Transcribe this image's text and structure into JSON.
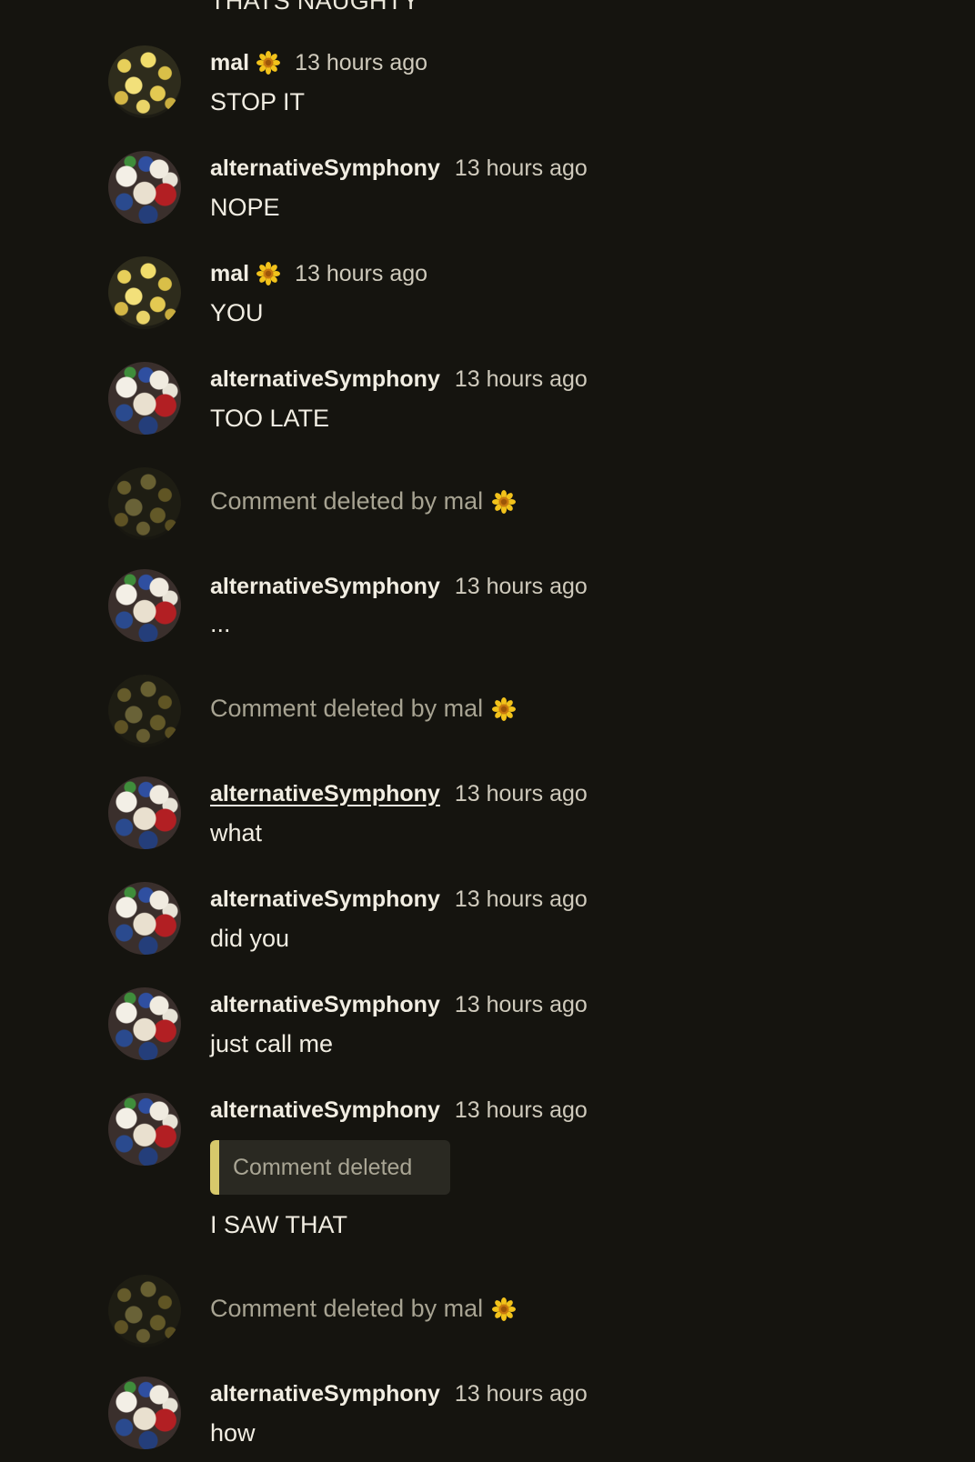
{
  "top_partial_text": "THATS NAUGHTY",
  "colors": {
    "background": "#15140f",
    "quote_bar": "#d7c96b",
    "muted_text": "#a7a392"
  },
  "icons": {
    "author_badge": "sunflower-icon"
  },
  "comments": [
    {
      "author": "mal",
      "time": "13 hours ago",
      "text": "STOP IT"
    },
    {
      "author": "alternativeSymphony",
      "time": "13 hours ago",
      "text": "NOPE"
    },
    {
      "author": "mal",
      "time": "13 hours ago",
      "text": "YOU"
    },
    {
      "author": "alternativeSymphony",
      "time": "13 hours ago",
      "text": "TOO LATE"
    },
    {
      "deleted_text": "Comment deleted by mal"
    },
    {
      "author": "alternativeSymphony",
      "time": "13 hours ago",
      "text": "..."
    },
    {
      "deleted_text": "Comment deleted by mal"
    },
    {
      "author": "alternativeSymphony",
      "time": "13 hours ago",
      "text": "what"
    },
    {
      "author": "alternativeSymphony",
      "time": "13 hours ago",
      "text": "did you"
    },
    {
      "author": "alternativeSymphony",
      "time": "13 hours ago",
      "text": "just call me"
    },
    {
      "author": "alternativeSymphony",
      "time": "13 hours ago",
      "quote": "Comment deleted",
      "text": "I SAW THAT"
    },
    {
      "deleted_text": "Comment deleted by mal"
    },
    {
      "author": "alternativeSymphony",
      "time": "13 hours ago",
      "text": "how"
    }
  ]
}
